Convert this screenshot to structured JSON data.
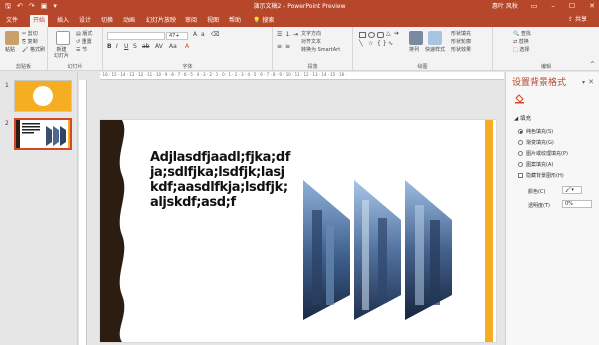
{
  "titlebar": {
    "title": "演示文稿2 - PowerPoint Preview",
    "user": "惠叶 风秋"
  },
  "tabs": [
    "文件",
    "开始",
    "插入",
    "设计",
    "切换",
    "动画",
    "幻灯片放映",
    "审阅",
    "视图",
    "帮助"
  ],
  "search_label": "搜索",
  "share_label": "共享",
  "ribbon": {
    "clipboard": {
      "paste": "粘贴",
      "cut": "剪切",
      "copy": "复制",
      "format_painter": "格式刷",
      "label": "剪贴板"
    },
    "slides": {
      "new_slide": "新建\n幻灯片",
      "layout": "版式",
      "reset": "重置",
      "section": "节",
      "label": "幻灯片"
    },
    "font": {
      "size": "47+",
      "label": "字体"
    },
    "paragraph": {
      "text_direction": "文字方向",
      "align_text": "对齐文本",
      "smartart": "转换为 SmartArt",
      "label": "段落"
    },
    "drawing": {
      "arrange": "排列",
      "quick_styles": "快速样式",
      "shape_fill": "形状填充",
      "shape_outline": "形状轮廓",
      "shape_effects": "形状效果",
      "label": "绘图"
    },
    "editing": {
      "find": "查找",
      "replace": "替换",
      "select": "选择",
      "label": "编辑"
    }
  },
  "thumbnails": [
    {
      "number": "1"
    },
    {
      "number": "2"
    }
  ],
  "ruler_text": "· 16 · 15 · 14 · 13 · 12 · 11 · 10 · 9 · 8 · 7 · 6 · 5 · 4 · 3 · 2 · 1 · 0 · 1 · 2 · 3 · 4 · 5 · 6 · 7 · 8 · 9 · 10 · 11 · 12 · 13 · 14 · 15 · 16 ·",
  "slide": {
    "body_text": "Adjlasdfjaadl;fjka;dfja;sdlfjka;lsdfjk;lasjkdf;aasdlfkja;lsdfjk;aljskdf;asd;f"
  },
  "format_pane": {
    "title": "设置背景格式",
    "section": "填充",
    "options": [
      {
        "label": "纯色填充(S)",
        "selected": true
      },
      {
        "label": "渐变填充(G)",
        "selected": false
      },
      {
        "label": "图片或纹理填充(P)",
        "selected": false
      },
      {
        "label": "图案填充(A)",
        "selected": false
      }
    ],
    "hide_bg_label": "隐藏背景图形(H)",
    "color_label": "颜色(C)",
    "transparency_label": "透明度(T)",
    "transparency_value": "0%"
  },
  "colors": {
    "accent": "#b7472a",
    "slide_bar": "#f5ae22",
    "wave_panel": "#2b1d12"
  }
}
